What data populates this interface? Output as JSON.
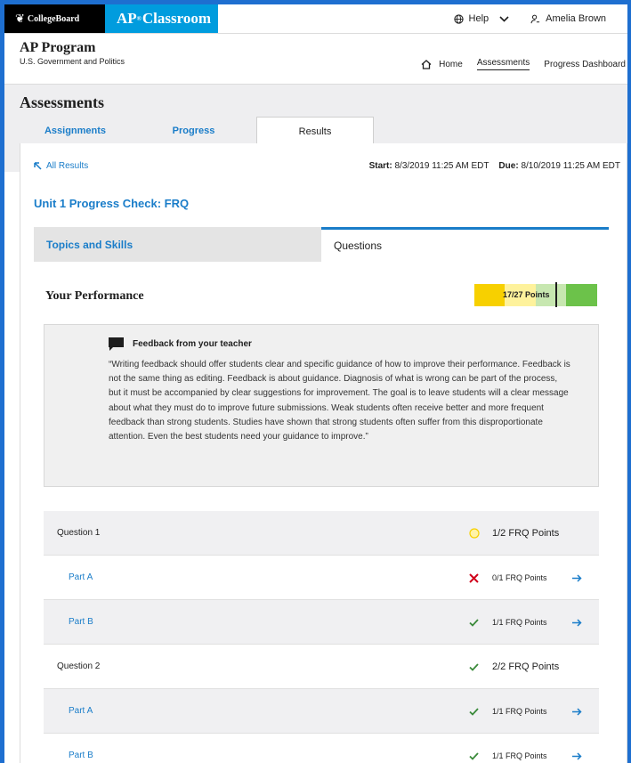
{
  "header": {
    "logo_text": "CollegeBoard",
    "app_name": "AP",
    "app_sup": "®",
    "app_name_rest": "Classroom",
    "help_label": "Help",
    "user_name": "Amelia Brown"
  },
  "program": {
    "title": "AP Program",
    "subtitle": "U.S. Government and Politics",
    "nav": [
      {
        "label": "Home",
        "icon": "home-icon"
      },
      {
        "label": "Assessments",
        "active": true
      },
      {
        "label": "Progress Dashboard"
      }
    ]
  },
  "page": {
    "title": "Assessments",
    "tabs": [
      {
        "label": "Assignments"
      },
      {
        "label": "Progress"
      },
      {
        "label": "Results",
        "active": true
      }
    ]
  },
  "results": {
    "back_label": "All Results",
    "start_label": "Start:",
    "start_value": "8/3/2019  11:25 AM EDT",
    "due_label": "Due:",
    "due_value": "8/10/2019  11:25 AM EDT",
    "title": "Unit 1 Progress Check: FRQ",
    "subtabs": [
      {
        "label": "Topics and Skills"
      },
      {
        "label": "Questions",
        "active": true
      }
    ]
  },
  "performance": {
    "title": "Your Performance",
    "points_label": "17/27 Points",
    "score": 17,
    "total": 27,
    "colors": {
      "low": "#f7d000",
      "mid": "#fef29c",
      "light": "#c7e7b0",
      "high": "#6cc24a"
    }
  },
  "feedback": {
    "heading": "Feedback from your teacher",
    "text": "“Writing feedback should offer students clear and specific guidance of how to improve their performance. Feedback is not the same thing as editing. Feedback is about guidance. Diagnosis of what is wrong can be part of the process, but it must be accompanied by clear suggestions for improvement. The goal is to leave students will a clear message about what they must do to improve future submissions. Weak students often receive better and more frequent feedback than strong students. Studies have shown that strong students often suffer from this disproportionate attention. Even the best students need your guidance to improve.”"
  },
  "questions": [
    {
      "kind": "question",
      "name": "Question 1",
      "status": "partial",
      "points": "1/2 FRQ Points"
    },
    {
      "kind": "part",
      "name": "Part A",
      "status": "incorrect",
      "points": "0/1 FRQ Points"
    },
    {
      "kind": "part",
      "name": "Part B",
      "status": "correct",
      "points": "1/1 FRQ Points"
    },
    {
      "kind": "question",
      "name": "Question 2",
      "status": "correct",
      "points": "2/2 FRQ Points"
    },
    {
      "kind": "part",
      "name": "Part A",
      "status": "correct",
      "points": "1/1 FRQ Points"
    },
    {
      "kind": "part",
      "name": "Part B",
      "status": "correct",
      "points": "1/1 FRQ Points"
    }
  ],
  "status_colors": {
    "correct": "#3a8a3a",
    "incorrect": "#d0021b",
    "partial": "#f7d000",
    "link": "#1a7dc9"
  }
}
